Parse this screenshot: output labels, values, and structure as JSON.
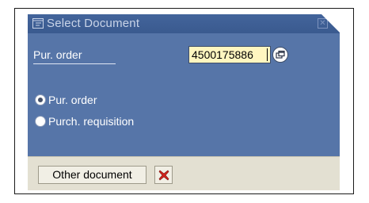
{
  "dialog": {
    "title": "Select Document"
  },
  "field": {
    "label": "Pur. order",
    "value": "4500175886"
  },
  "options": [
    {
      "label": "Pur. order",
      "selected": true
    },
    {
      "label": "Purch. requisition",
      "selected": false
    }
  ],
  "footer": {
    "other_document_label": "Other document"
  },
  "icons": {
    "title": "dialog-icon",
    "close": "close-icon",
    "f4": "value-help-icon",
    "cancel": "red-x-icon"
  },
  "colors": {
    "dialog_bg": "#5675a8",
    "titlebar": "#3a5a8f",
    "input_bg": "#fff6c0",
    "footer_bg": "#e3e0d2",
    "cancel_red": "#d2231c"
  }
}
